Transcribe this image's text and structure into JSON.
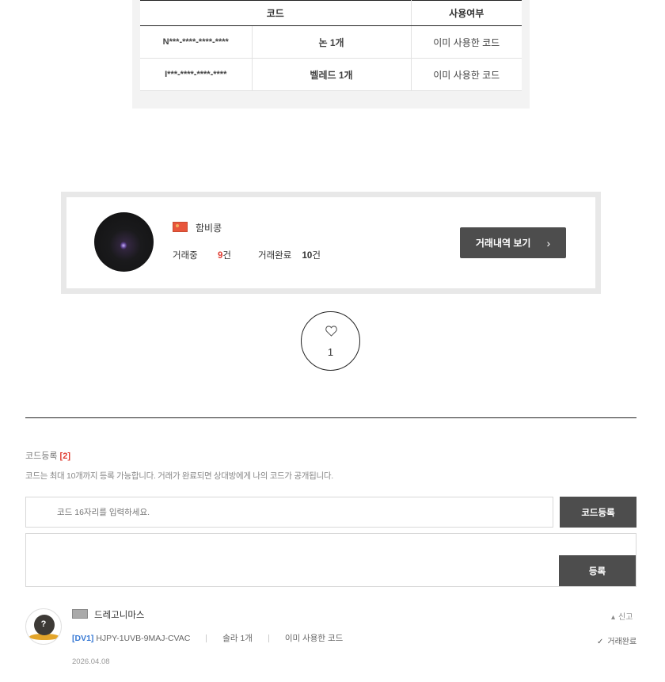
{
  "code_table": {
    "headers": [
      "코드",
      "사용여부"
    ],
    "rows": [
      {
        "code": "N***-****-****-****",
        "item": "논 1개",
        "status": "이미 사용한 코드"
      },
      {
        "code": "I***-****-****-****",
        "item": "벨레드 1개",
        "status": "이미 사용한 코드"
      }
    ]
  },
  "seller": {
    "name": "함비콩",
    "trading_label": "거래중",
    "trading_count": "9",
    "completed_label": "거래완료",
    "completed_count": "10",
    "unit": "건",
    "history_button": "거래내역 보기",
    "history_icon": "chevron-right-icon"
  },
  "like": {
    "icon": "heart-icon",
    "count": "1"
  },
  "registration": {
    "title": "코드등록",
    "count": "[2]",
    "description": "코드는 최대 10개까지 등록 가능합니다. 거래가 완료되면 상대방에게 나의 코드가 공개됩니다.",
    "input_placeholder": "코드 16자리를 입력하세요.",
    "register_button": "코드등록",
    "submit_button": "등록"
  },
  "comment": {
    "user": "드레고니마스",
    "report_label": "신고",
    "report_icon": "user-icon",
    "server_tag": "[DV1]",
    "code": "HJPY-1UVB-9MAJ-CVAC",
    "item": "솔라 1개",
    "status": "이미 사용한 코드",
    "trade_status": "거래완료",
    "trade_status_icon": "check-icon",
    "date": "2026.04.08"
  },
  "colors": {
    "accent_red": "#e03c31",
    "button_dark": "#4d4d4d",
    "link_blue": "#3a7bd5"
  }
}
